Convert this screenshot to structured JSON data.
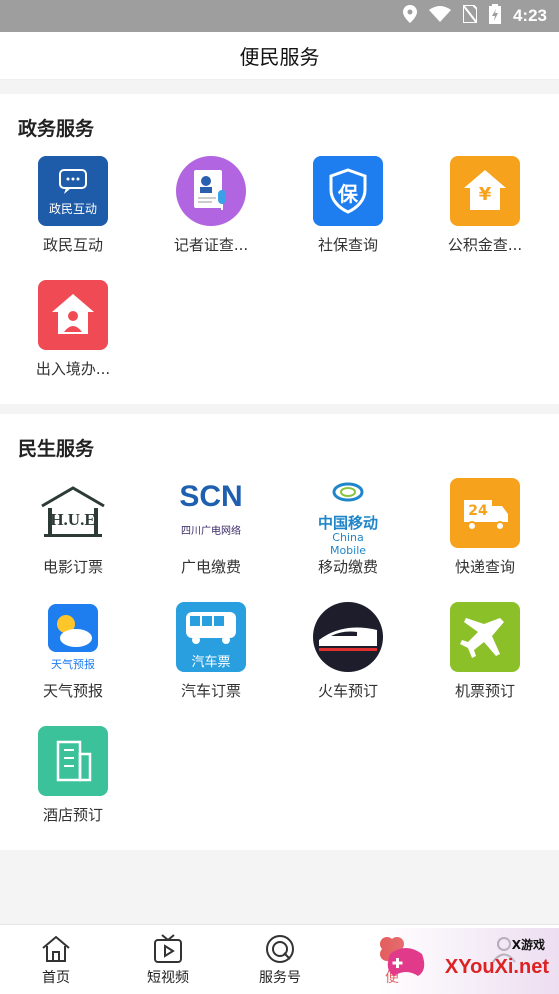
{
  "status_bar": {
    "time": "4:23"
  },
  "header": {
    "title": "便民服务"
  },
  "sections": [
    {
      "title": "政务服务",
      "items": [
        {
          "label": "政民互动",
          "icon": "chat-bubble-icon",
          "icon_text": "政民互动",
          "color": "#1e5ba8"
        },
        {
          "label": "记者证查...",
          "icon": "reporter-badge-icon",
          "color": "#b265e0"
        },
        {
          "label": "社保查询",
          "icon": "shield-icon",
          "icon_text": "保",
          "color": "#1e7ef0"
        },
        {
          "label": "公积金查...",
          "icon": "house-yuan-icon",
          "icon_text": "¥",
          "color": "#f6a21c"
        },
        {
          "label": "出入境办...",
          "icon": "house-person-icon",
          "color": "#f04b55"
        }
      ]
    },
    {
      "title": "民生服务",
      "items": [
        {
          "label": "电影订票",
          "icon": "hue-logo-icon",
          "icon_text": "H.U.E"
        },
        {
          "label": "广电缴费",
          "icon": "scn-logo-icon",
          "icon_text": "SCN",
          "icon_subtext": "四川广电网络"
        },
        {
          "label": "移动缴费",
          "icon": "china-mobile-logo-icon",
          "icon_text": "中国移动",
          "icon_subtext": "China Mobile"
        },
        {
          "label": "快递查询",
          "icon": "delivery-truck-icon",
          "icon_text": "24",
          "color": "#f6a21c"
        },
        {
          "label": "天气预报",
          "icon": "weather-sun-cloud-icon",
          "icon_text": "天气预报",
          "color": "#1e7ef0"
        },
        {
          "label": "汽车订票",
          "icon": "bus-icon",
          "icon_text": "汽车票",
          "color": "#2a9fe0"
        },
        {
          "label": "火车预订",
          "icon": "train-icon",
          "color": "#1d1d2b"
        },
        {
          "label": "机票预订",
          "icon": "airplane-icon",
          "color": "#8cc028"
        },
        {
          "label": "酒店预订",
          "icon": "building-icon",
          "color": "#3cc29a"
        }
      ]
    }
  ],
  "tabs": [
    {
      "label": "首页",
      "icon": "home-icon"
    },
    {
      "label": "短视频",
      "icon": "tv-play-icon"
    },
    {
      "label": "服务号",
      "icon": "q-circle-icon"
    },
    {
      "label": "便",
      "icon": "clover-icon",
      "active": true
    },
    {
      "label": "",
      "icon": "user-icon"
    }
  ],
  "watermark": {
    "text": "XYouXi.net",
    "sub": "X游戏"
  }
}
